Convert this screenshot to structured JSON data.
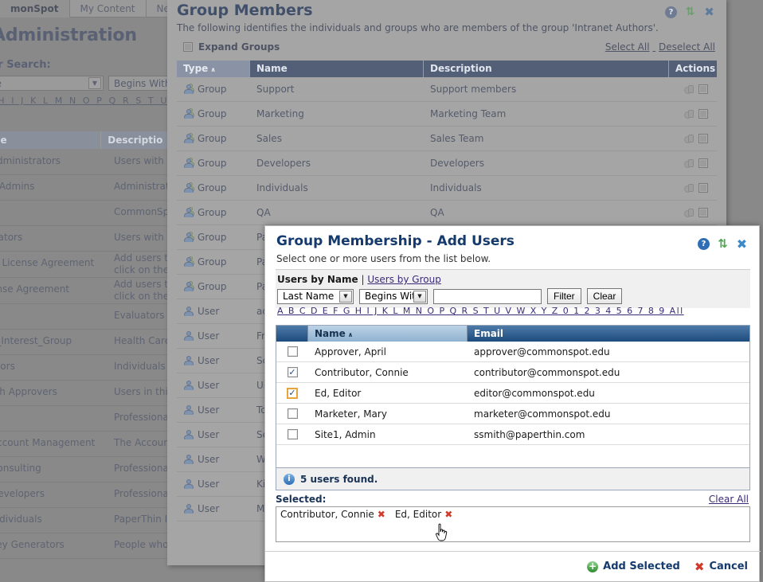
{
  "background": {
    "tabs": [
      {
        "label": "monSpot",
        "active": true
      },
      {
        "label": "My Content",
        "active": false
      },
      {
        "label": "New",
        "active": false
      }
    ],
    "page_title": "Administration",
    "search_label": "ur Search:",
    "field_select": "ne",
    "operator_select": "Begins With",
    "alphabet": "G H I J K L M N O P Q R S T U V W X",
    "table_headers": {
      "name": "me",
      "description": "Descriptio"
    },
    "rows": [
      {
        "name": "Administrators",
        "desc": "Users with "
      },
      {
        "name": "y Admins",
        "desc": "Administrat"
      },
      {
        "name": "",
        "desc": "CommonSp"
      },
      {
        "name": "trators",
        "desc": "Users with "
      },
      {
        "name": "al License Agreement",
        "desc": "Add users t\nclick on the"
      },
      {
        "name": "ense Agreement",
        "desc": "Add users t\nclick on the"
      },
      {
        "name": "",
        "desc": "Evaluators"
      },
      {
        "name": "e_Interest_Group",
        "desc": "Health Care"
      },
      {
        "name": "thors",
        "desc": "Individuals"
      },
      {
        "name": "tch Approvers",
        "desc": "Users in thi"
      },
      {
        "name": "",
        "desc": "Professiona"
      },
      {
        "name": "Account Management",
        "desc": "The Accoun"
      },
      {
        "name": "Consulting",
        "desc": "Professiona"
      },
      {
        "name": "Developers",
        "desc": "Professiona"
      },
      {
        "name": "Individuals",
        "desc": "PaperThin I"
      },
      {
        "name": "Key Generators",
        "desc": "People who"
      }
    ]
  },
  "group_members": {
    "title": "Group Members",
    "description": "The following identifies the individuals and groups who are members of the group 'Intranet Authors'.",
    "expand_groups_label": "Expand Groups",
    "select_all": "Select All",
    "deselect_all": "Deselect All",
    "columns": {
      "type": "Type",
      "name": "Name",
      "description": "Description",
      "actions": "Actions"
    },
    "sort_caret": "∧",
    "rows": [
      {
        "type": "Group",
        "name": "Support",
        "desc": "Support members"
      },
      {
        "type": "Group",
        "name": "Marketing",
        "desc": "Marketing Team"
      },
      {
        "type": "Group",
        "name": "Sales",
        "desc": "Sales Team"
      },
      {
        "type": "Group",
        "name": "Developers",
        "desc": "Developers"
      },
      {
        "type": "Group",
        "name": "Individuals",
        "desc": "Individuals"
      },
      {
        "type": "Group",
        "name": "QA",
        "desc": "QA"
      },
      {
        "type": "Group",
        "name": "Pa",
        "desc": ""
      },
      {
        "type": "Group",
        "name": "Pa",
        "desc": ""
      },
      {
        "type": "Group",
        "name": "Pa",
        "desc": ""
      },
      {
        "type": "User",
        "name": "ad",
        "desc": ""
      },
      {
        "type": "User",
        "name": "Fra",
        "desc": ""
      },
      {
        "type": "User",
        "name": "Sc",
        "desc": ""
      },
      {
        "type": "User",
        "name": "Un",
        "desc": ""
      },
      {
        "type": "User",
        "name": "To",
        "desc": ""
      },
      {
        "type": "User",
        "name": "Se",
        "desc": ""
      },
      {
        "type": "User",
        "name": "Wi",
        "desc": ""
      },
      {
        "type": "User",
        "name": "Kin",
        "desc": ""
      },
      {
        "type": "User",
        "name": "Ma",
        "desc": ""
      }
    ],
    "icons": {
      "help": "?",
      "refresh": "⇅",
      "close": "✖"
    }
  },
  "modal": {
    "title": "Group Membership - Add Users",
    "subtitle": "Select one or more users from the list below.",
    "icons": {
      "help": "?",
      "refresh": "⇅",
      "close": "✖"
    },
    "tab_by_name": "Users by Name",
    "tab_separator": "|",
    "tab_by_group": "Users by Group",
    "field_select": "Last Name",
    "operator_select": "Begins With",
    "search_value": "",
    "search_placeholder": "",
    "filter_button": "Filter",
    "clear_button": "Clear",
    "alphabet": "A B C D E F G H I J K L M N O P Q R S T U V W X Y Z 0 1 2 3 4 5 6 7 8 9 All",
    "table": {
      "headers": {
        "name": "Name",
        "email": "Email"
      },
      "sort_caret": "∧",
      "rows": [
        {
          "checked": false,
          "focused": false,
          "name": "Approver, April",
          "email": "approver@commonspot.edu"
        },
        {
          "checked": true,
          "focused": false,
          "name": "Contributor, Connie",
          "email": "contributor@commonspot.edu"
        },
        {
          "checked": true,
          "focused": true,
          "name": "Ed, Editor",
          "email": "editor@commonspot.edu"
        },
        {
          "checked": false,
          "focused": false,
          "name": "Marketer, Mary",
          "email": "marketer@commonspot.edu"
        },
        {
          "checked": false,
          "focused": false,
          "name": "Site1, Admin",
          "email": "ssmith@paperthin.com"
        }
      ]
    },
    "status_text": "5 users found.",
    "selected_label": "Selected:",
    "clear_all": "Clear All",
    "selected_chips": [
      {
        "name": "Contributor, Connie",
        "remove": "✖"
      },
      {
        "name": "Ed, Editor",
        "remove": "✖"
      }
    ],
    "add_selected": "Add Selected",
    "cancel": "Cancel",
    "add_icon": "+",
    "cancel_icon": "✖"
  },
  "colors": {
    "modal_title": "#153a6e",
    "link": "#3b2a78",
    "table_header": "#1c4b7d",
    "accent_orange": "#e8a33d",
    "remove_red": "#d03a2a",
    "add_green": "#2e8b2e"
  }
}
